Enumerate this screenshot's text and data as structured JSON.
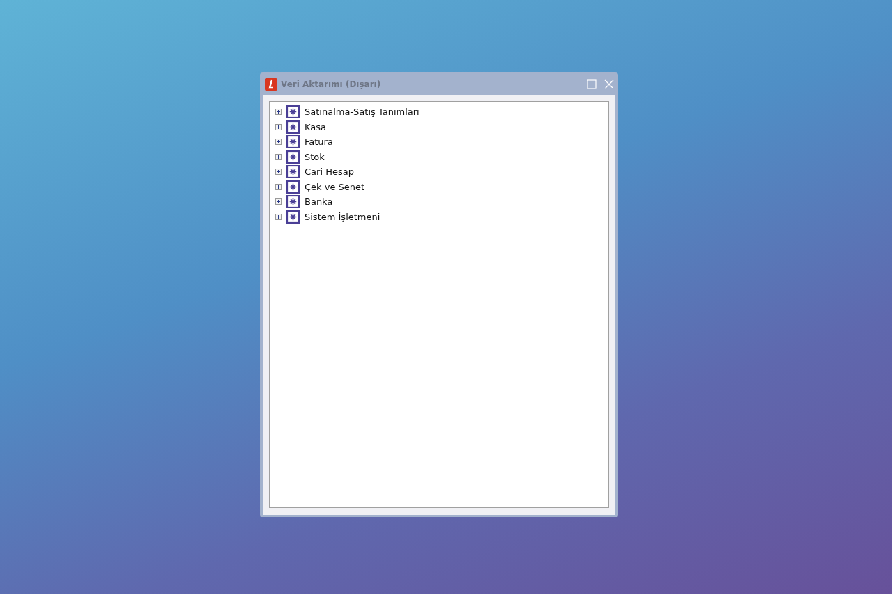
{
  "window": {
    "title": "Veri Aktarımı (Dışarı)"
  },
  "tree": {
    "items": [
      {
        "label": "Satınalma-Satış Tanımları",
        "expanded": false
      },
      {
        "label": "Kasa",
        "expanded": false
      },
      {
        "label": "Fatura",
        "expanded": false
      },
      {
        "label": "Stok",
        "expanded": false
      },
      {
        "label": "Cari Hesap",
        "expanded": false
      },
      {
        "label": "Çek ve Senet",
        "expanded": false
      },
      {
        "label": "Banka",
        "expanded": false
      },
      {
        "label": "Sistem İşletmeni",
        "expanded": false
      }
    ]
  }
}
